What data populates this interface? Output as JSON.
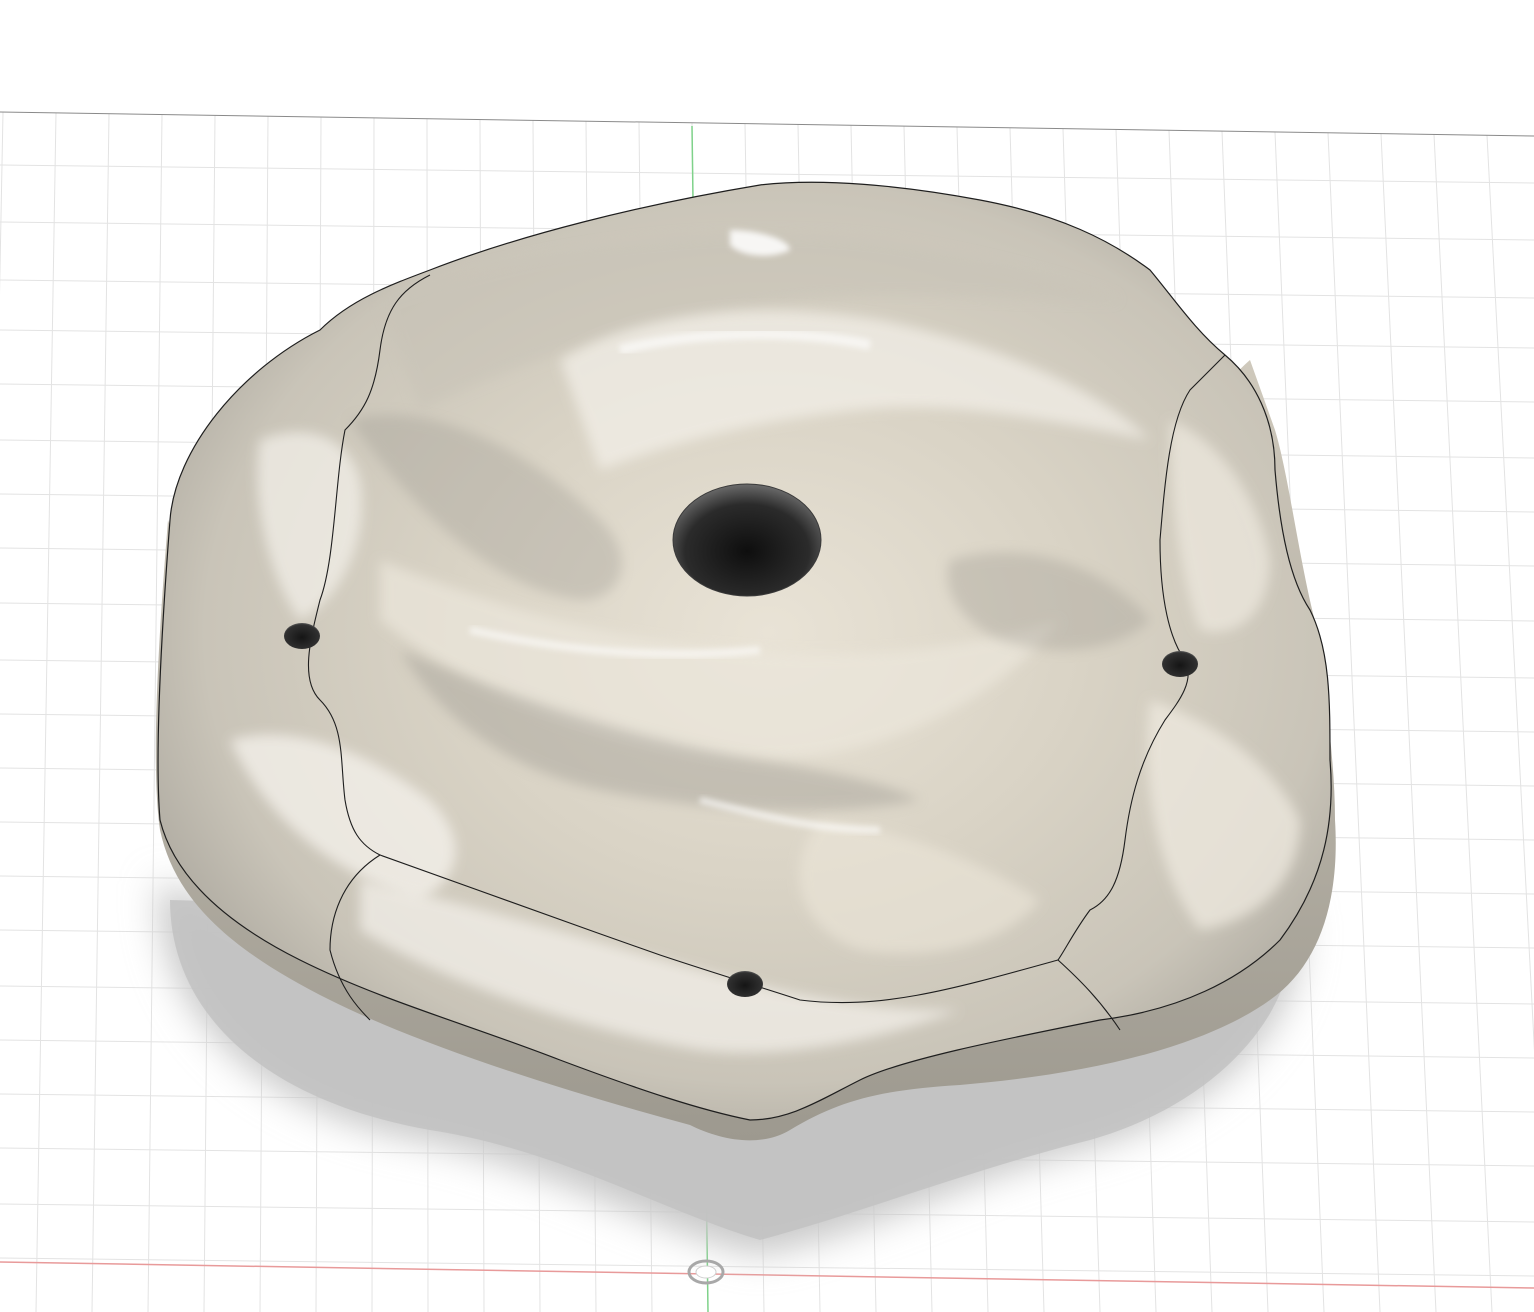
{
  "viewport": {
    "background_color": "#ffffff",
    "grid_color": "#e3e3e3",
    "horizon_line_color": "#8a8a8a",
    "y_axis_color": "#7fd28a",
    "x_axis_color": "#e89a9a"
  },
  "model": {
    "body_color": "#d8d2c4",
    "highlight_color": "#f7f4ee",
    "shadow_color": "#8f8a80",
    "edge_color": "#1e1e1e",
    "hole_color": "#2a2a2a",
    "ground_shadow_color": "#c9c9c9"
  },
  "origin_marker": {
    "icon": "origin-ring-icon",
    "color": "#a8a8a8"
  }
}
